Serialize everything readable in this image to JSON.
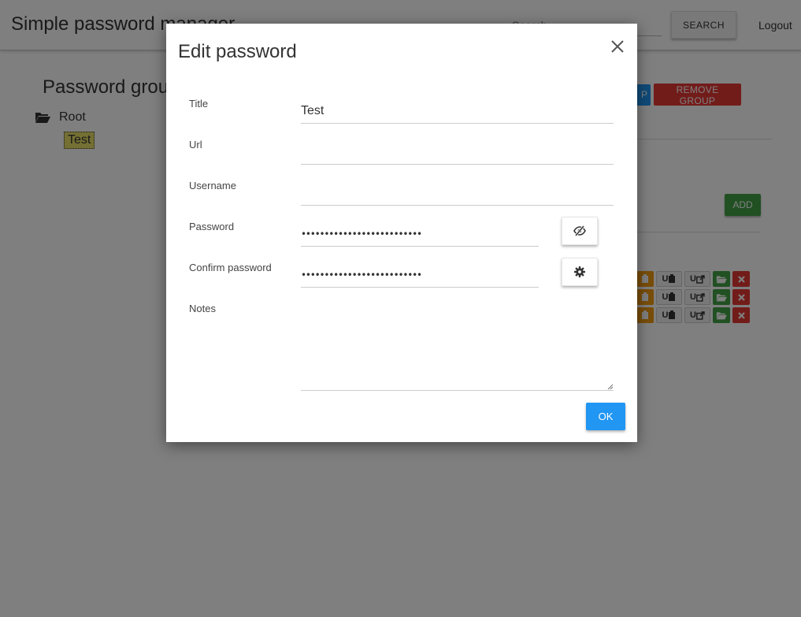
{
  "app": {
    "title": "Simple password manager",
    "search_placeholder": "Search",
    "search_button": "SEARCH",
    "logout": "Logout"
  },
  "groups": {
    "heading": "Password groups",
    "root_label": "Root",
    "child_label": "Test",
    "remove_group": "REMOVE GROUP",
    "add": "ADD"
  },
  "entry_actions": {
    "username_copy_label": "U",
    "username_open_label": "U"
  },
  "modal": {
    "title": "Edit password",
    "fields": {
      "title_label": "Title",
      "title_value": "Test",
      "url_label": "Url",
      "url_value": "",
      "username_label": "Username",
      "username_value": "",
      "password_label": "Password",
      "password_value": "••••••••••••••••••••••••••",
      "confirm_label": "Confirm password",
      "confirm_value": "••••••••••••••••••••••••••",
      "notes_label": "Notes",
      "notes_value": ""
    },
    "ok_button": "OK"
  },
  "icons": {
    "close": "close-icon",
    "show_password": "eye-slash-icon",
    "generate_password": "gear-icon",
    "folder_open": "folder-open-icon"
  },
  "colors": {
    "primary": "#2196f3",
    "danger": "#e53935",
    "success": "#43a047",
    "warning": "#f39c12",
    "highlight": "#e8e066"
  }
}
